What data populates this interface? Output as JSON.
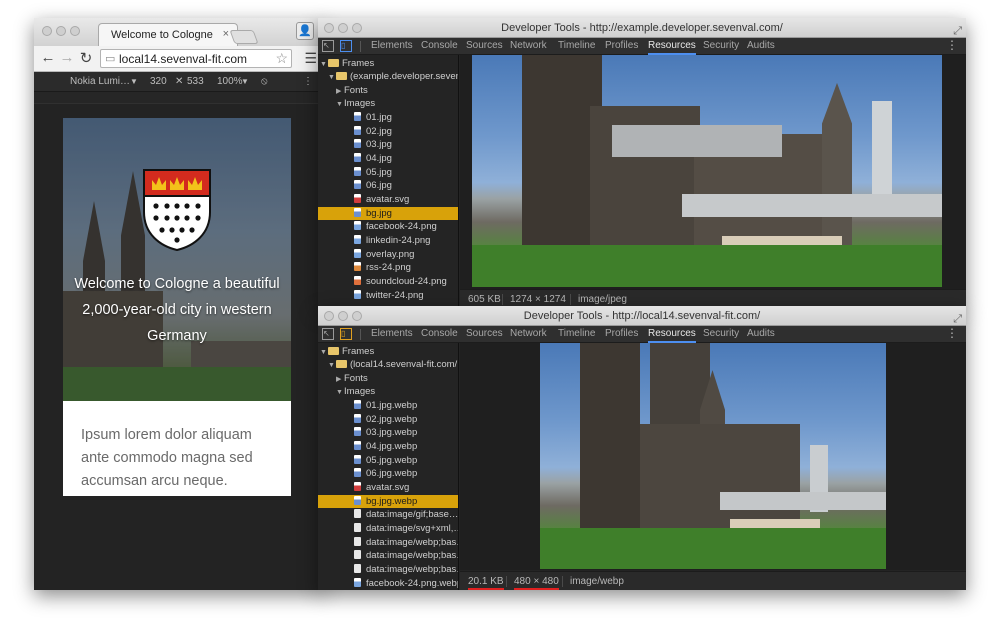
{
  "browser": {
    "tab_title": "Welcome to Cologne",
    "tab_close": "×",
    "url": "local14.sevenval-fit.com",
    "emulation": {
      "device": "Nokia Lumi…",
      "device_arrow": "▼",
      "width": "320",
      "times": "✕",
      "height": "533",
      "zoom": "100%",
      "zoom_arrow": "▼",
      "rotate_icon": "⦸",
      "more": "⋮"
    },
    "page": {
      "hero_text": "Welcome to Cologne a beautiful 2,000-year-old city in western Germany",
      "body_text": "Ipsum lorem dolor aliquam ante commodo magna sed accumsan arcu neque."
    }
  },
  "devtools_tabs": [
    "Elements",
    "Console",
    "Sources",
    "Network",
    "Timeline",
    "Profiles",
    "Resources",
    "Security",
    "Audits"
  ],
  "devtools": [
    {
      "title": "Developer Tools - http://example.developer.sevenval.com/",
      "active_tab": "Resources",
      "frames_label": "Frames",
      "frame_name": "(example.developer.seven",
      "fonts_label": "Fonts",
      "images_label": "Images",
      "files": [
        "01.jpg",
        "02.jpg",
        "03.jpg",
        "04.jpg",
        "05.jpg",
        "06.jpg",
        "avatar.svg",
        "bg.jpg",
        "facebook-24.png",
        "linkedin-24.png",
        "overlay.png",
        "rss-24.png",
        "soundcloud-24.png",
        "twitter-24.png"
      ],
      "selected_file": "bg.jpg",
      "status": {
        "size": "605 KB",
        "dimensions": "1274 × 1274",
        "mime": "image/jpeg"
      }
    },
    {
      "title": "Developer Tools - http://local14.sevenval-fit.com/",
      "active_tab": "Resources",
      "frames_label": "Frames",
      "frame_name": "(local14.sevenval-fit.com/",
      "fonts_label": "Fonts",
      "images_label": "Images",
      "files": [
        "01.jpg.webp",
        "02.jpg.webp",
        "03.jpg.webp",
        "04.jpg.webp",
        "05.jpg.webp",
        "06.jpg.webp",
        "avatar.svg",
        "bg.jpg.webp",
        "data:image/gif;base…",
        "data:image/svg+xml,…",
        "data:image/webp;bas…",
        "data:image/webp;bas…",
        "data:image/webp;bas…",
        "facebook-24.png.webp"
      ],
      "selected_file": "bg.jpg.webp",
      "status": {
        "size": "20.1 KB",
        "dimensions": "480 × 480",
        "mime": "image/webp"
      }
    }
  ]
}
